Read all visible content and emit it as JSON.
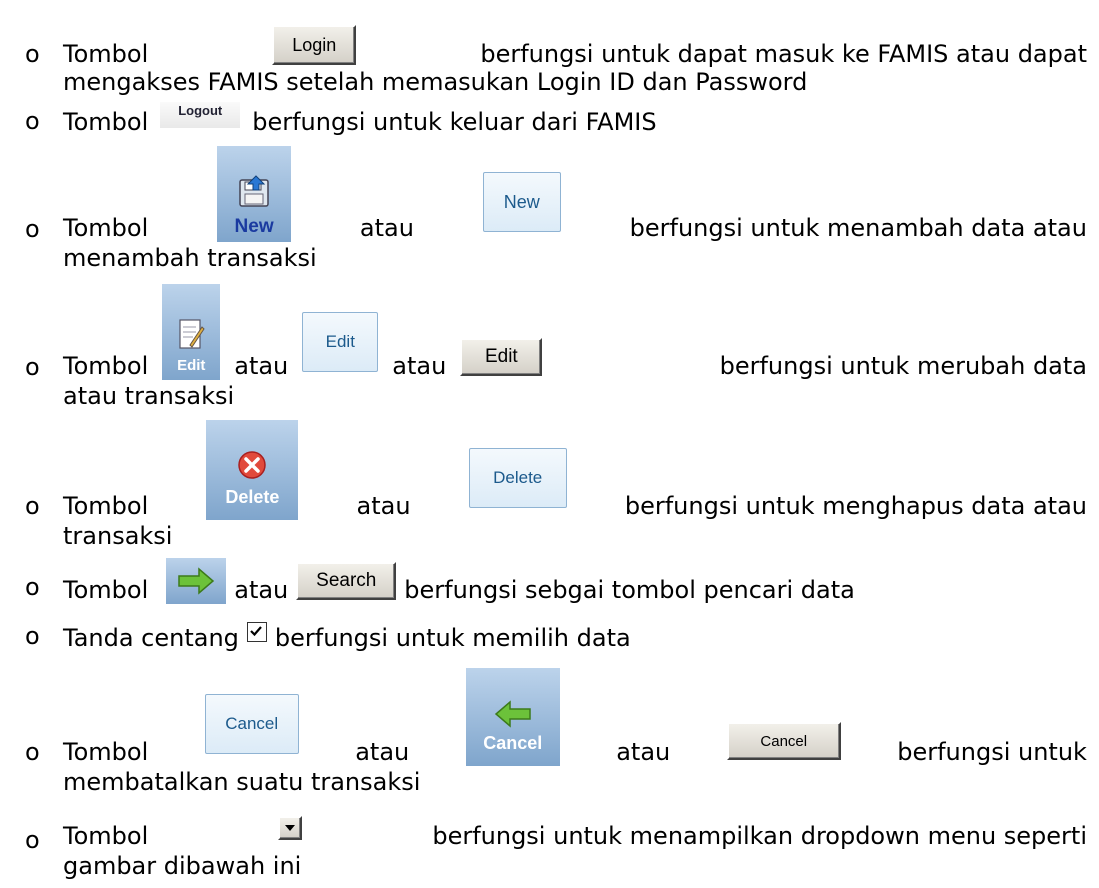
{
  "bullet_glyph": "o",
  "items": [
    {
      "prefix": "Tombol",
      "icon_label": "Login",
      "text": "berfungsi untuk dapat masuk ke FAMIS atau dapat",
      "text2": "mengakses FAMIS setelah memasukan Login ID dan Password"
    },
    {
      "prefix": "Tombol",
      "icon_label": "Logout",
      "text": "berfungsi untuk keluar dari FAMIS"
    },
    {
      "prefix": "Tombol",
      "icon_tile_label": "New",
      "connector": "atau",
      "icon_button_label": "New",
      "text": "berfungsi untuk menambah data atau",
      "text2": "menambah transaksi"
    },
    {
      "prefix": "Tombol",
      "icon_tile_label": "Edit",
      "connector": "atau",
      "icon_button_label": "Edit",
      "connector2": "atau",
      "icon_gray_label": "Edit",
      "text": "berfungsi untuk merubah data",
      "text2": "atau transaksi"
    },
    {
      "prefix": "Tombol",
      "icon_tile_label": "Delete",
      "connector": "atau",
      "icon_button_label": "Delete",
      "text": "berfungsi untuk menghapus data atau",
      "text2": "transaksi"
    },
    {
      "prefix": "Tombol",
      "connector": "atau",
      "icon_gray_label": "Search",
      "text": "berfungsi sebgai tombol pencari data"
    },
    {
      "prefix": "Tanda centang",
      "text": "berfungsi untuk memilih data"
    },
    {
      "prefix": "Tombol",
      "icon_button_label": "Cancel",
      "connector": "atau",
      "icon_tile_label": "Cancel",
      "connector2": "atau",
      "icon_gray_label": "Cancel",
      "text": "berfungsi untuk",
      "text2": "membatalkan suatu transaksi"
    },
    {
      "prefix": "Tombol",
      "text": "berfungsi untuk menampilkan dropdown menu seperti",
      "text2": "gambar dibawah ini"
    }
  ],
  "colors": {
    "tile_top": "#bcd3eb",
    "tile_bottom": "#7fa5cc",
    "tile_text_blue": "#1a3aa0",
    "tile_text_white": "#ffffff",
    "button_blue_border": "#8fb3d3",
    "button_blue_text": "#1c5a8c"
  }
}
